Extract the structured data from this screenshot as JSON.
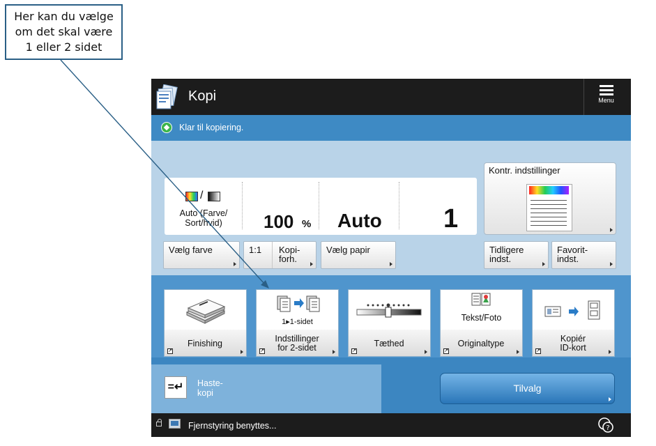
{
  "callout": {
    "lines": [
      "Her kan du vælge",
      "om det skal være",
      "1 eller 2 sidet"
    ]
  },
  "titlebar": {
    "title": "Kopi",
    "menu_label": "Menu"
  },
  "status": {
    "text": "Klar til kopiering."
  },
  "summary": {
    "color_mode_line1": "Auto (Farve/",
    "color_mode_line2": "Sort/hvid)",
    "zoom": "100",
    "zoom_unit": "%",
    "paper": "Auto",
    "quantity": "1"
  },
  "check_settings": {
    "label": "Kontr. indstillinger"
  },
  "buttons": {
    "select_color": "Vælg farve",
    "ratio_1_1": "1:1",
    "copy_ratio_line1": "Kopi-",
    "copy_ratio_line2": "forh.",
    "select_paper": "Vælg papir",
    "previous_line1": "Tidligere",
    "previous_line2": "indst.",
    "favorite_line1": "Favorit-",
    "favorite_line2": "indst."
  },
  "functions": [
    {
      "line1": "Finishing",
      "line2": "",
      "sub": ""
    },
    {
      "line1": "Indstillinger",
      "line2": "for 2-sidet",
      "sub": "1▸1-sidet"
    },
    {
      "line1": "Tæthed",
      "line2": "",
      "sub": ""
    },
    {
      "line1": "Originaltype",
      "line2": "",
      "sub": "Tekst/Foto"
    },
    {
      "line1": "Kopiér",
      "line2": "ID-kort",
      "sub": ""
    }
  ],
  "express_copy": {
    "line1": "Haste-",
    "line2": "kopi"
  },
  "options_button": {
    "label": "Tilvalg"
  },
  "footer": {
    "text": "Fjernstyring benyttes..."
  },
  "colors": {
    "titlebar": "#1c1c1c",
    "status_bar": "#3e8ac4",
    "panel_bg": "#b9d3e8",
    "function_area": "#4f95cd",
    "accent_blue": "#2a76b8",
    "callout_border": "#2a5f86",
    "ready_green": "#3bb54a"
  },
  "icons": [
    "copy-app-icon",
    "menu-icon",
    "ready-icon",
    "color-mode-icon",
    "document-preview-icon",
    "finishing-icon",
    "two-sided-icon",
    "density-icon",
    "original-type-icon",
    "id-card-copy-icon",
    "express-copy-icon",
    "lock-icon",
    "remote-monitor-icon",
    "help-icon"
  ]
}
